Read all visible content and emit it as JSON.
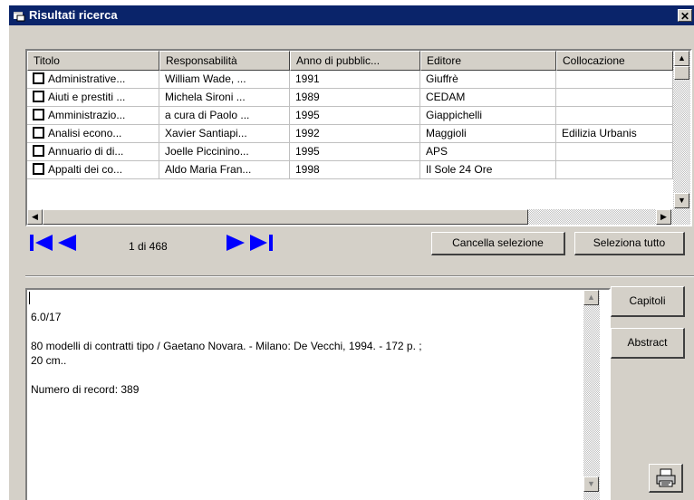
{
  "window": {
    "title": "Risultati ricerca",
    "close_label": "✕"
  },
  "grid": {
    "columns": [
      "Titolo",
      "Responsabilità",
      "Anno di pubblic...",
      "Editore",
      "Collocazione"
    ],
    "rows": [
      {
        "titolo": "Administrative...",
        "resp": "William Wade, ...",
        "anno": "1991",
        "editore": "Giuffrè",
        "colloc": ""
      },
      {
        "titolo": "Aiuti e prestiti ...",
        "resp": "Michela Sironi ...",
        "anno": "1989",
        "editore": "CEDAM",
        "colloc": ""
      },
      {
        "titolo": "Amministrazio...",
        "resp": "a cura di Paolo ...",
        "anno": "1995",
        "editore": "Giappichelli",
        "colloc": ""
      },
      {
        "titolo": "Analisi econo...",
        "resp": "Xavier Santiapi...",
        "anno": "1992",
        "editore": "Maggioli",
        "colloc": "Edilizia Urbanis"
      },
      {
        "titolo": "Annuario di di...",
        "resp": "Joelle Piccinino...",
        "anno": "1995",
        "editore": "APS",
        "colloc": ""
      },
      {
        "titolo": "Appalti dei co...",
        "resp": "Aldo Maria Fran...",
        "anno": "1998",
        "editore": "Il Sole 24 Ore",
        "colloc": ""
      }
    ]
  },
  "navigation": {
    "record_counter": "1 di 468"
  },
  "buttons": {
    "clear_selection": "Cancella selezione",
    "select_all": "Seleziona tutto",
    "chapters": "Capitoli",
    "abstract": "Abstract"
  },
  "detail": {
    "line1": "6.0/17",
    "line2": "80 modelli di contratti tipo / Gaetano Novara. - Milano: De Vecchi, 1994. - 172 p. ;",
    "line3": "20 cm..",
    "line4": "Numero di record: 389"
  },
  "icons": {
    "first": "first-record-icon",
    "prev": "previous-record-icon",
    "next": "next-record-icon",
    "last": "last-record-icon",
    "print": "printer-icon"
  },
  "colors": {
    "titlebar": "#0a246a",
    "nav_arrows": "#0000ff",
    "face": "#d4d0c8"
  }
}
